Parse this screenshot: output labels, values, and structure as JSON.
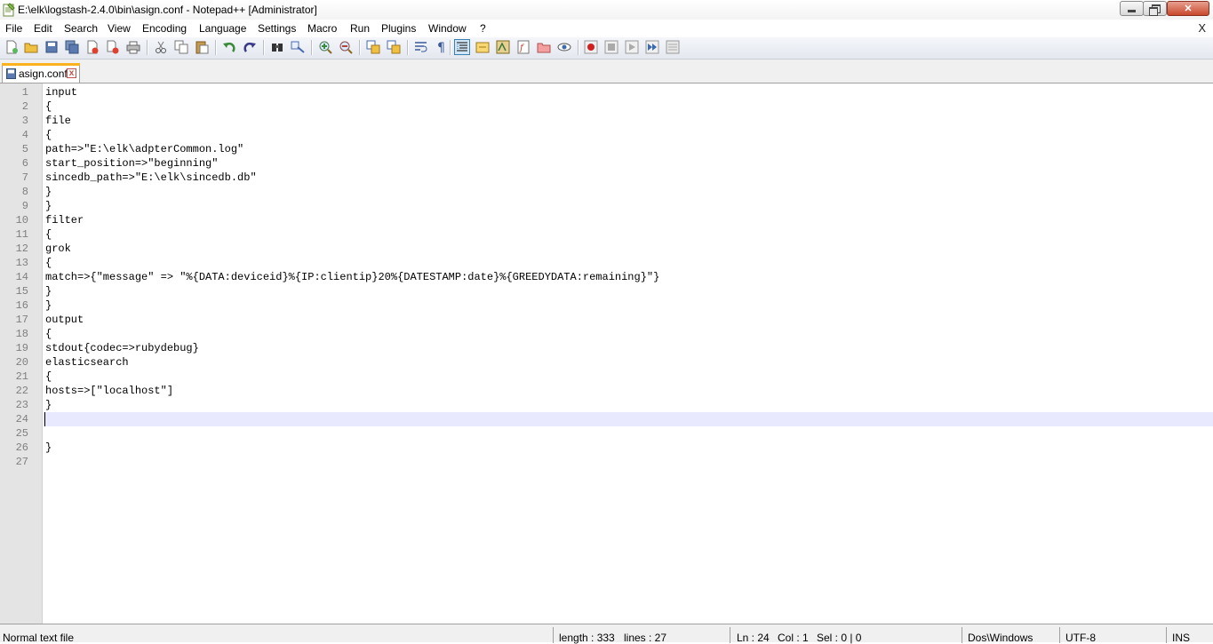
{
  "window": {
    "title": "E:\\elk\\logstash-2.4.0\\bin\\asign.conf - Notepad++ [Administrator]",
    "minimize_icon": "minimize-icon",
    "maximize_icon": "restore-icon",
    "close_icon": "close-icon",
    "close_glyph": "✕"
  },
  "menu": {
    "items": [
      "File",
      "Edit",
      "Search",
      "View",
      "Encoding",
      "Language",
      "Settings",
      "Macro",
      "Run",
      "Plugins",
      "Window",
      "?"
    ],
    "close_label": "X"
  },
  "toolbar": {
    "icons": [
      "new-file-icon",
      "open-file-icon",
      "save-icon",
      "save-all-icon",
      "close-icon",
      "close-all-icon",
      "print-icon",
      "cut-icon",
      "copy-icon",
      "paste-icon",
      "undo-icon",
      "redo-icon",
      "find-icon",
      "replace-icon",
      "zoom-in-icon",
      "zoom-out-icon",
      "sync-vertical-icon",
      "sync-horizontal-icon",
      "word-wrap-icon",
      "show-all-chars-icon",
      "indent-guide-icon",
      "user-defined-language-icon",
      "document-map-icon",
      "function-list-icon",
      "folder-as-workspace-icon",
      "monitoring-icon",
      "record-macro-icon",
      "stop-macro-icon",
      "play-macro-icon",
      "run-macro-multiple-icon",
      "save-macro-icon"
    ]
  },
  "tab": {
    "label": "asign.conf",
    "close_glyph": "x"
  },
  "editor": {
    "current_line": 24,
    "lines": [
      "input",
      "{",
      "file",
      "{",
      "path=>\"E:\\elk\\adpterCommon.log\"",
      "start_position=>\"beginning\"",
      "sincedb_path=>\"E:\\elk\\sincedb.db\"",
      "}",
      "}",
      "filter",
      "{",
      "grok",
      "{",
      "match=>{\"message\" => \"%{DATA:deviceid}%{IP:clientip}20%{DATESTAMP:date}%{GREEDYDATA:remaining}\"}",
      "}",
      "}",
      "output",
      "{",
      "stdout{codec=>rubydebug}",
      "elasticsearch",
      "{",
      "hosts=>[\"localhost\"]",
      "}",
      "",
      "",
      "}",
      ""
    ]
  },
  "status": {
    "file_type": "Normal text file",
    "length": "length : 333",
    "lines": "lines : 27",
    "ln": "Ln : 24",
    "col": "Col : 1",
    "sel": "Sel : 0 | 0",
    "eol": "Dos\\Windows",
    "encoding": "UTF-8",
    "mode": "INS"
  },
  "colors": {
    "current_line": "#e8e8ff",
    "gutter": "#e4e4e4",
    "tab_accent": "#fab31e"
  }
}
